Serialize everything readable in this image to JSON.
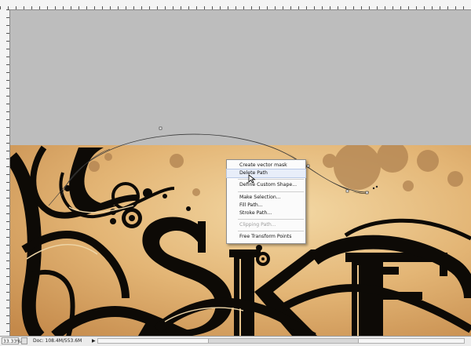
{
  "context_menu": {
    "items": [
      {
        "label": "Create vector mask",
        "highlighted": false,
        "disabled": false
      },
      {
        "label": "Delete Path",
        "highlighted": true,
        "disabled": false
      },
      {
        "label": "Define Custom Shape...",
        "highlighted": false,
        "disabled": false
      },
      {
        "label": "Make Selection...",
        "highlighted": false,
        "disabled": false
      },
      {
        "label": "Fill Path...",
        "highlighted": false,
        "disabled": false
      },
      {
        "label": "Stroke Path...",
        "highlighted": false,
        "disabled": false
      },
      {
        "label": "Clipping Path...",
        "highlighted": false,
        "disabled": true
      },
      {
        "label": "Free Transform Points",
        "highlighted": false,
        "disabled": false
      }
    ]
  },
  "status_bar": {
    "zoom": "33.33%",
    "doc_info": "Doc: 108.4M/553.6M",
    "arrow": "▶"
  },
  "canvas": {
    "artwork_letters": [
      "S",
      "K",
      "E"
    ],
    "parchment_color": "#e3b575",
    "ink_color": "#0d0a06",
    "pasteboard_color": "#bdbdbd"
  }
}
